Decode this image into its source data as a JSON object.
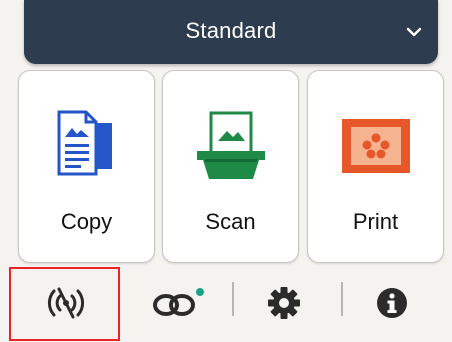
{
  "header": {
    "mode_selector_label": "Standard",
    "dropdown_icon": "chevron-down-icon"
  },
  "tiles": [
    {
      "label": "Copy",
      "icon": "copy-icon"
    },
    {
      "label": "Scan",
      "icon": "scan-icon"
    },
    {
      "label": "Print",
      "icon": "print-icon"
    }
  ],
  "bottom_bar": {
    "items": [
      {
        "icon": "wireless-off-icon"
      },
      {
        "icon": "link-status-icon"
      },
      {
        "icon": "settings-icon"
      },
      {
        "icon": "info-icon"
      }
    ]
  },
  "colors": {
    "header_bg": "#2e3c4f",
    "focus_outline": "#e8232a",
    "copy_blue": "#2456c9",
    "scan_green": "#1f8a47",
    "print_orange": "#e6572a",
    "icon_dark": "#2b2b2b",
    "status_dot": "#19a48a"
  }
}
